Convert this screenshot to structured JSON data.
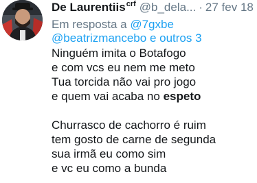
{
  "tweet": {
    "display_name": "De Laurentiis",
    "badge": "crf",
    "handle": "@b_dela...",
    "separator": "·",
    "timestamp": "27 fev 18",
    "reply_prefix": "Em resposta a",
    "reply_to_first": "@7gxbe",
    "reply_to_rest": "@beatrizmancebo e outros 3",
    "stanza1": {
      "line1": "Ninguém imita o Botafogo",
      "line2": "e com vcs eu nem me meto",
      "line3": "Tua torcida não vai pro jogo",
      "line4_prefix": "e quem vai acaba no",
      "line4_bold": "espeto"
    },
    "stanza2": {
      "line1": "Churrasco de cachorro é ruim",
      "line2": "tem gosto de carne de segunda",
      "line3": "sua irmã eu como sim",
      "line4": "e vc eu como a bunda"
    }
  },
  "colors": {
    "text": "#14171a",
    "muted": "#657786",
    "link": "#1da1f2"
  },
  "icons": {
    "avatar": "profile-photo"
  }
}
